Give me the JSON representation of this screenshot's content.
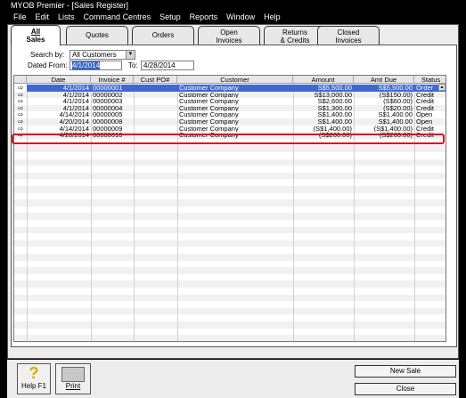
{
  "window": {
    "title": "MYOB Premier - [Sales Register]"
  },
  "menu": [
    "File",
    "Edit",
    "Lists",
    "Command Centres",
    "Setup",
    "Reports",
    "Window",
    "Help"
  ],
  "tabs": [
    {
      "line1": "All",
      "line2": "Sales",
      "active": true
    },
    {
      "line1": "Quotes",
      "line2": ""
    },
    {
      "line1": "Orders",
      "line2": ""
    },
    {
      "line1": "Open",
      "line2": "Invoices"
    },
    {
      "line1": "Returns",
      "line2": "& Credits"
    },
    {
      "line1": "Closed",
      "line2": "Invoices"
    }
  ],
  "filters": {
    "search_by_label": "Search by:",
    "search_by_value": "All Customers",
    "dated_from_label": "Dated From:",
    "dated_from_value": "4/1/2014",
    "to_label": "To:",
    "to_value": "4/28/2014"
  },
  "table": {
    "headers": [
      "Date",
      "Invoice #",
      "Cust PO#",
      "Customer",
      "Amount",
      "Amt Due",
      "Status"
    ],
    "rows": [
      {
        "date": "4/1/2014",
        "invoice": "00000001",
        "po": "",
        "customer": "Customer Company",
        "amount": "S$5,500.00",
        "due": "S$5,500.00",
        "status": "Order",
        "selected": true
      },
      {
        "date": "4/1/2014",
        "invoice": "00000002",
        "po": "",
        "customer": "Customer Company",
        "amount": "S$13,000.00",
        "due": "(S$150.00)",
        "status": "Credit"
      },
      {
        "date": "4/1/2014",
        "invoice": "00000003",
        "po": "",
        "customer": "Customer Company",
        "amount": "S$2,600.00",
        "due": "(S$60.00)",
        "status": "Credit"
      },
      {
        "date": "4/1/2014",
        "invoice": "00000004",
        "po": "",
        "customer": "Customer Company",
        "amount": "S$1,300.00",
        "due": "(S$20.00)",
        "status": "Credit"
      },
      {
        "date": "4/14/2014",
        "invoice": "00000005",
        "po": "",
        "customer": "Customer Company",
        "amount": "S$1,400.00",
        "due": "S$1,400.00",
        "status": "Open"
      },
      {
        "date": "4/20/2014",
        "invoice": "00000008",
        "po": "",
        "customer": "Customer Company",
        "amount": "S$1,400.00",
        "due": "S$1,400.00",
        "status": "Open"
      },
      {
        "date": "4/14/2014",
        "invoice": "00000009",
        "po": "",
        "customer": "Customer Company",
        "amount": "(S$1,400.00)",
        "due": "(S$1,400.00)",
        "status": "Credit"
      },
      {
        "date": "4/28/2014",
        "invoice": "00000010",
        "po": "",
        "customer": "Customer Company",
        "amount": "(S$260.00)",
        "due": "(S$260.00)",
        "status": "Credit",
        "highlighted": true
      }
    ]
  },
  "bottom": {
    "help_label": "Help F1",
    "print_label": "Print",
    "new_sale_label": "New Sale",
    "close_label": "Close"
  },
  "colors": {
    "selection": "#3f68d0",
    "highlight_border": "#d4161c"
  }
}
